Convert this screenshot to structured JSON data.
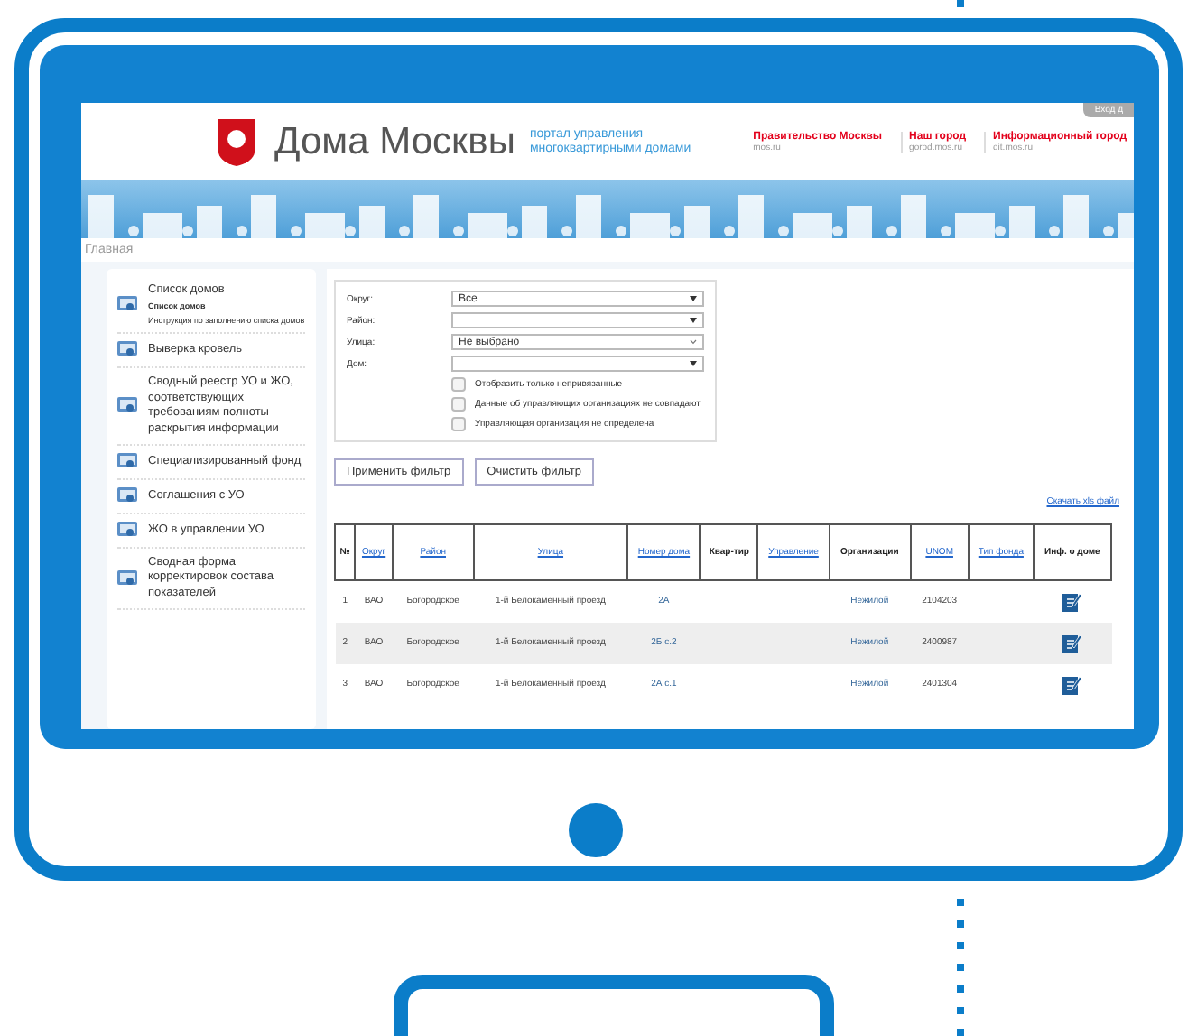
{
  "header": {
    "title": "Дома Москвы",
    "tagline": "портал управления многоквартирными домами",
    "login_tab": "Вход д",
    "links": [
      {
        "label": "Правительство Москвы",
        "url": "mos.ru"
      },
      {
        "label": "Наш город",
        "url": "gorod.mos.ru"
      },
      {
        "label": "Информационный город",
        "url": "dit.mos.ru"
      }
    ]
  },
  "breadcrumb": "Главная",
  "sidebar": {
    "items": [
      {
        "label": "Список домов",
        "children": [
          {
            "label": "Список домов",
            "bold": true
          },
          {
            "label": "Инструкция по заполнению списка домов",
            "bold": false
          }
        ]
      },
      {
        "label": "Выверка кровель"
      },
      {
        "label": "Сводный реестр УО и ЖО, соответствующих требованиям полноты раскрытия информации"
      },
      {
        "label": "Специализированный фонд"
      },
      {
        "label": "Соглашения с УО"
      },
      {
        "label": "ЖО в управлении УО"
      },
      {
        "label": "Сводная форма корректировок состава показателей"
      }
    ]
  },
  "filter": {
    "fields": [
      {
        "label": "Округ:",
        "value": "Все",
        "kind": "select"
      },
      {
        "label": "Район:",
        "kind": "select"
      },
      {
        "label": "Улица:",
        "value": "Не выбрано",
        "kind": "combo"
      },
      {
        "label": "Дом:",
        "kind": "select"
      }
    ],
    "checkboxes": [
      {
        "label": "Отобразить только непривязанные",
        "checked": false
      },
      {
        "label": "Данные об управляющих организациях не совпадают",
        "checked": false
      },
      {
        "label": "Управляющая организация не определена",
        "checked": false
      }
    ],
    "buttons": [
      "Применить фильтр",
      "Очистить фильтр"
    ]
  },
  "download_link": "Скачать xls файл",
  "table": {
    "columns": [
      {
        "label": "№",
        "link": false
      },
      {
        "label": "Округ",
        "link": true
      },
      {
        "label": "Район",
        "link": true
      },
      {
        "label": "Улица",
        "link": true
      },
      {
        "label": "Номер дома",
        "link": true
      },
      {
        "label": "Квар-тир",
        "link": false
      },
      {
        "label": "Управление",
        "link": true
      },
      {
        "label": "Организации",
        "link": false
      },
      {
        "label": "UNOM",
        "link": true
      },
      {
        "label": "Тип фонда",
        "link": true
      },
      {
        "label": "Инф. о доме",
        "link": false
      }
    ],
    "rows": [
      [
        "1",
        "ВАО",
        "Богородское",
        "1-й Белокаменный проезд",
        "2А",
        "",
        "",
        "Нежилой",
        "2104203",
        ""
      ],
      [
        "2",
        "ВАО",
        "Богородское",
        "1-й Белокаменный проезд",
        "2Б с.2",
        "",
        "",
        "Нежилой",
        "2400987",
        ""
      ],
      [
        "3",
        "ВАО",
        "Богородское",
        "1-й Белокаменный проезд",
        "2А с.1",
        "",
        "",
        "Нежилой",
        "2401304",
        ""
      ]
    ]
  }
}
